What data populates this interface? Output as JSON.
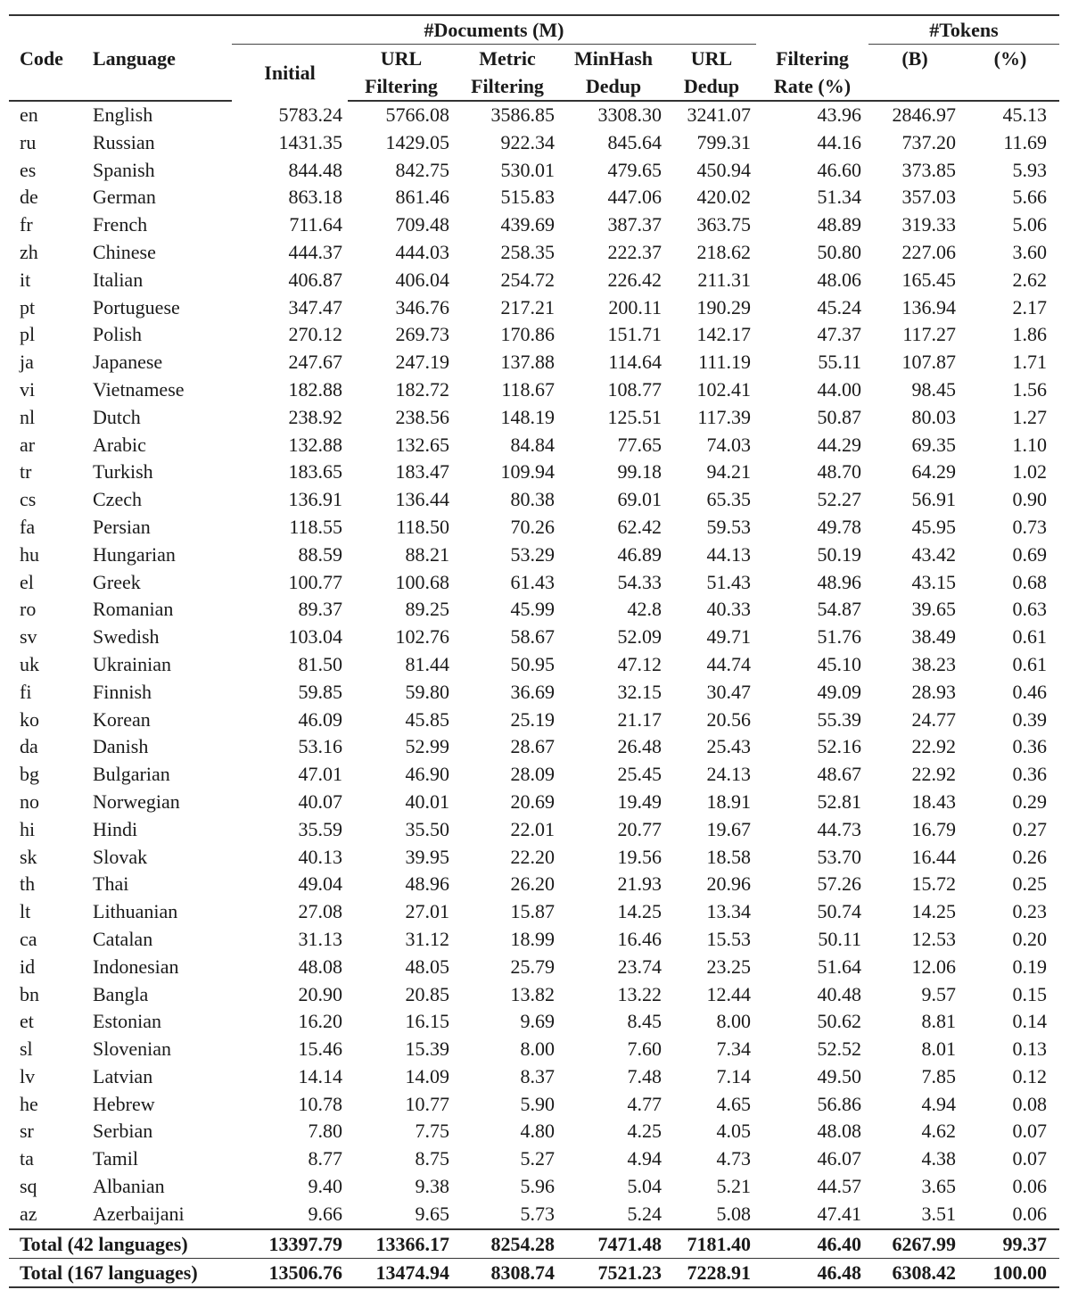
{
  "table": {
    "headers": {
      "code": "Code",
      "language": "Language",
      "documents_group": "#Documents (M)",
      "initial": "Initial",
      "url_filtering_1": "URL",
      "url_filtering_2": "Filtering",
      "metric_filtering_1": "Metric",
      "metric_filtering_2": "Filtering",
      "minhash_dedup_1": "MinHash",
      "minhash_dedup_2": "Dedup",
      "url_dedup_1": "URL",
      "url_dedup_2": "Dedup",
      "filtering_rate_1": "Filtering",
      "filtering_rate_2": "Rate (%)",
      "tokens_group": "#Tokens",
      "tokens_b": "(B)",
      "tokens_pct": "(%)"
    },
    "columns": [
      "Code",
      "Language",
      "Initial",
      "URL Filtering",
      "Metric Filtering",
      "MinHash Dedup",
      "URL Dedup",
      "Filtering Rate (%)",
      "#Tokens (B)",
      "#Tokens (%)"
    ],
    "rows": [
      [
        "en",
        "English",
        "5783.24",
        "5766.08",
        "3586.85",
        "3308.30",
        "3241.07",
        "43.96",
        "2846.97",
        "45.13"
      ],
      [
        "ru",
        "Russian",
        "1431.35",
        "1429.05",
        "922.34",
        "845.64",
        "799.31",
        "44.16",
        "737.20",
        "11.69"
      ],
      [
        "es",
        "Spanish",
        "844.48",
        "842.75",
        "530.01",
        "479.65",
        "450.94",
        "46.60",
        "373.85",
        "5.93"
      ],
      [
        "de",
        "German",
        "863.18",
        "861.46",
        "515.83",
        "447.06",
        "420.02",
        "51.34",
        "357.03",
        "5.66"
      ],
      [
        "fr",
        "French",
        "711.64",
        "709.48",
        "439.69",
        "387.37",
        "363.75",
        "48.89",
        "319.33",
        "5.06"
      ],
      [
        "zh",
        "Chinese",
        "444.37",
        "444.03",
        "258.35",
        "222.37",
        "218.62",
        "50.80",
        "227.06",
        "3.60"
      ],
      [
        "it",
        "Italian",
        "406.87",
        "406.04",
        "254.72",
        "226.42",
        "211.31",
        "48.06",
        "165.45",
        "2.62"
      ],
      [
        "pt",
        "Portuguese",
        "347.47",
        "346.76",
        "217.21",
        "200.11",
        "190.29",
        "45.24",
        "136.94",
        "2.17"
      ],
      [
        "pl",
        "Polish",
        "270.12",
        "269.73",
        "170.86",
        "151.71",
        "142.17",
        "47.37",
        "117.27",
        "1.86"
      ],
      [
        "ja",
        "Japanese",
        "247.67",
        "247.19",
        "137.88",
        "114.64",
        "111.19",
        "55.11",
        "107.87",
        "1.71"
      ],
      [
        "vi",
        "Vietnamese",
        "182.88",
        "182.72",
        "118.67",
        "108.77",
        "102.41",
        "44.00",
        "98.45",
        "1.56"
      ],
      [
        "nl",
        "Dutch",
        "238.92",
        "238.56",
        "148.19",
        "125.51",
        "117.39",
        "50.87",
        "80.03",
        "1.27"
      ],
      [
        "ar",
        "Arabic",
        "132.88",
        "132.65",
        "84.84",
        "77.65",
        "74.03",
        "44.29",
        "69.35",
        "1.10"
      ],
      [
        "tr",
        "Turkish",
        "183.65",
        "183.47",
        "109.94",
        "99.18",
        "94.21",
        "48.70",
        "64.29",
        "1.02"
      ],
      [
        "cs",
        "Czech",
        "136.91",
        "136.44",
        "80.38",
        "69.01",
        "65.35",
        "52.27",
        "56.91",
        "0.90"
      ],
      [
        "fa",
        "Persian",
        "118.55",
        "118.50",
        "70.26",
        "62.42",
        "59.53",
        "49.78",
        "45.95",
        "0.73"
      ],
      [
        "hu",
        "Hungarian",
        "88.59",
        "88.21",
        "53.29",
        "46.89",
        "44.13",
        "50.19",
        "43.42",
        "0.69"
      ],
      [
        "el",
        "Greek",
        "100.77",
        "100.68",
        "61.43",
        "54.33",
        "51.43",
        "48.96",
        "43.15",
        "0.68"
      ],
      [
        "ro",
        "Romanian",
        "89.37",
        "89.25",
        "45.99",
        "42.8",
        "40.33",
        "54.87",
        "39.65",
        "0.63"
      ],
      [
        "sv",
        "Swedish",
        "103.04",
        "102.76",
        "58.67",
        "52.09",
        "49.71",
        "51.76",
        "38.49",
        "0.61"
      ],
      [
        "uk",
        "Ukrainian",
        "81.50",
        "81.44",
        "50.95",
        "47.12",
        "44.74",
        "45.10",
        "38.23",
        "0.61"
      ],
      [
        "fi",
        "Finnish",
        "59.85",
        "59.80",
        "36.69",
        "32.15",
        "30.47",
        "49.09",
        "28.93",
        "0.46"
      ],
      [
        "ko",
        "Korean",
        "46.09",
        "45.85",
        "25.19",
        "21.17",
        "20.56",
        "55.39",
        "24.77",
        "0.39"
      ],
      [
        "da",
        "Danish",
        "53.16",
        "52.99",
        "28.67",
        "26.48",
        "25.43",
        "52.16",
        "22.92",
        "0.36"
      ],
      [
        "bg",
        "Bulgarian",
        "47.01",
        "46.90",
        "28.09",
        "25.45",
        "24.13",
        "48.67",
        "22.92",
        "0.36"
      ],
      [
        "no",
        "Norwegian",
        "40.07",
        "40.01",
        "20.69",
        "19.49",
        "18.91",
        "52.81",
        "18.43",
        "0.29"
      ],
      [
        "hi",
        "Hindi",
        "35.59",
        "35.50",
        "22.01",
        "20.77",
        "19.67",
        "44.73",
        "16.79",
        "0.27"
      ],
      [
        "sk",
        "Slovak",
        "40.13",
        "39.95",
        "22.20",
        "19.56",
        "18.58",
        "53.70",
        "16.44",
        "0.26"
      ],
      [
        "th",
        "Thai",
        "49.04",
        "48.96",
        "26.20",
        "21.93",
        "20.96",
        "57.26",
        "15.72",
        "0.25"
      ],
      [
        "lt",
        "Lithuanian",
        "27.08",
        "27.01",
        "15.87",
        "14.25",
        "13.34",
        "50.74",
        "14.25",
        "0.23"
      ],
      [
        "ca",
        "Catalan",
        "31.13",
        "31.12",
        "18.99",
        "16.46",
        "15.53",
        "50.11",
        "12.53",
        "0.20"
      ],
      [
        "id",
        "Indonesian",
        "48.08",
        "48.05",
        "25.79",
        "23.74",
        "23.25",
        "51.64",
        "12.06",
        "0.19"
      ],
      [
        "bn",
        "Bangla",
        "20.90",
        "20.85",
        "13.82",
        "13.22",
        "12.44",
        "40.48",
        "9.57",
        "0.15"
      ],
      [
        "et",
        "Estonian",
        "16.20",
        "16.15",
        "9.69",
        "8.45",
        "8.00",
        "50.62",
        "8.81",
        "0.14"
      ],
      [
        "sl",
        "Slovenian",
        "15.46",
        "15.39",
        "8.00",
        "7.60",
        "7.34",
        "52.52",
        "8.01",
        "0.13"
      ],
      [
        "lv",
        "Latvian",
        "14.14",
        "14.09",
        "8.37",
        "7.48",
        "7.14",
        "49.50",
        "7.85",
        "0.12"
      ],
      [
        "he",
        "Hebrew",
        "10.78",
        "10.77",
        "5.90",
        "4.77",
        "4.65",
        "56.86",
        "4.94",
        "0.08"
      ],
      [
        "sr",
        "Serbian",
        "7.80",
        "7.75",
        "4.80",
        "4.25",
        "4.05",
        "48.08",
        "4.62",
        "0.07"
      ],
      [
        "ta",
        "Tamil",
        "8.77",
        "8.75",
        "5.27",
        "4.94",
        "4.73",
        "46.07",
        "4.38",
        "0.07"
      ],
      [
        "sq",
        "Albanian",
        "9.40",
        "9.38",
        "5.96",
        "5.04",
        "5.21",
        "44.57",
        "3.65",
        "0.06"
      ],
      [
        "az",
        "Azerbaijani",
        "9.66",
        "9.65",
        "5.73",
        "5.24",
        "5.08",
        "47.41",
        "3.51",
        "0.06"
      ]
    ],
    "totals": [
      [
        "Total (42 languages)",
        "13397.79",
        "13366.17",
        "8254.28",
        "7471.48",
        "7181.40",
        "46.40",
        "6267.99",
        "99.37"
      ],
      [
        "Total (167 languages)",
        "13506.76",
        "13474.94",
        "8308.74",
        "7521.23",
        "7228.91",
        "46.48",
        "6308.42",
        "100.00"
      ]
    ]
  }
}
